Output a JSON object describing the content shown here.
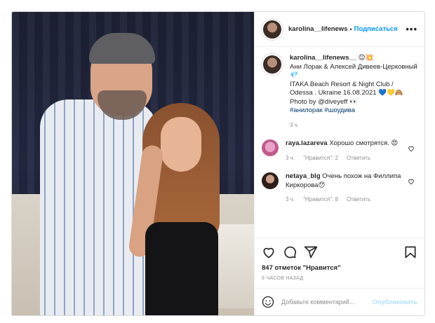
{
  "post": {
    "username": "karolina__lifenews",
    "follow_label": "Подписаться",
    "more_label": "•••"
  },
  "caption": {
    "username": "karolina__lifenews__",
    "emoji": "😊💥",
    "line1": "Ани Лорак & Алексей Дивеев-Церковный 💎",
    "line2": "ITAKA Beach Resort & Night Club / Odessa . Ukraine 16.08.2021 💙💛🙈",
    "line3": "Photo by @diveyeff 👀",
    "hashtags": "#анилорак #шоудива",
    "time": "3 ч."
  },
  "comments": [
    {
      "username": "raya.lazareva",
      "text": "Хорошо смотрятся. 😍",
      "time": "3 ч.",
      "likes": "\"Нравится\": 2",
      "reply": "Ответить"
    },
    {
      "username": "netaya_blg",
      "text": "Очень похож на Филлипа Киркорова😯",
      "time": "3 ч.",
      "likes": "\"Нравится\": 8",
      "reply": "Ответить"
    }
  ],
  "stats": {
    "likes": "847 отметок \"Нравится\"",
    "posted": "9 ЧАСОВ НАЗАД"
  },
  "add_comment": {
    "placeholder": "Добавьте комментарий...",
    "publish_label": "Опубликовать"
  },
  "colors": {
    "accent": "#0095f6",
    "publish_disabled": "#b2dffc",
    "meta": "#8e8e8e"
  },
  "icons": {
    "like": "heart-icon",
    "comment": "comment-icon",
    "share": "share-icon",
    "save": "bookmark-icon",
    "emoji": "smiley-icon"
  }
}
